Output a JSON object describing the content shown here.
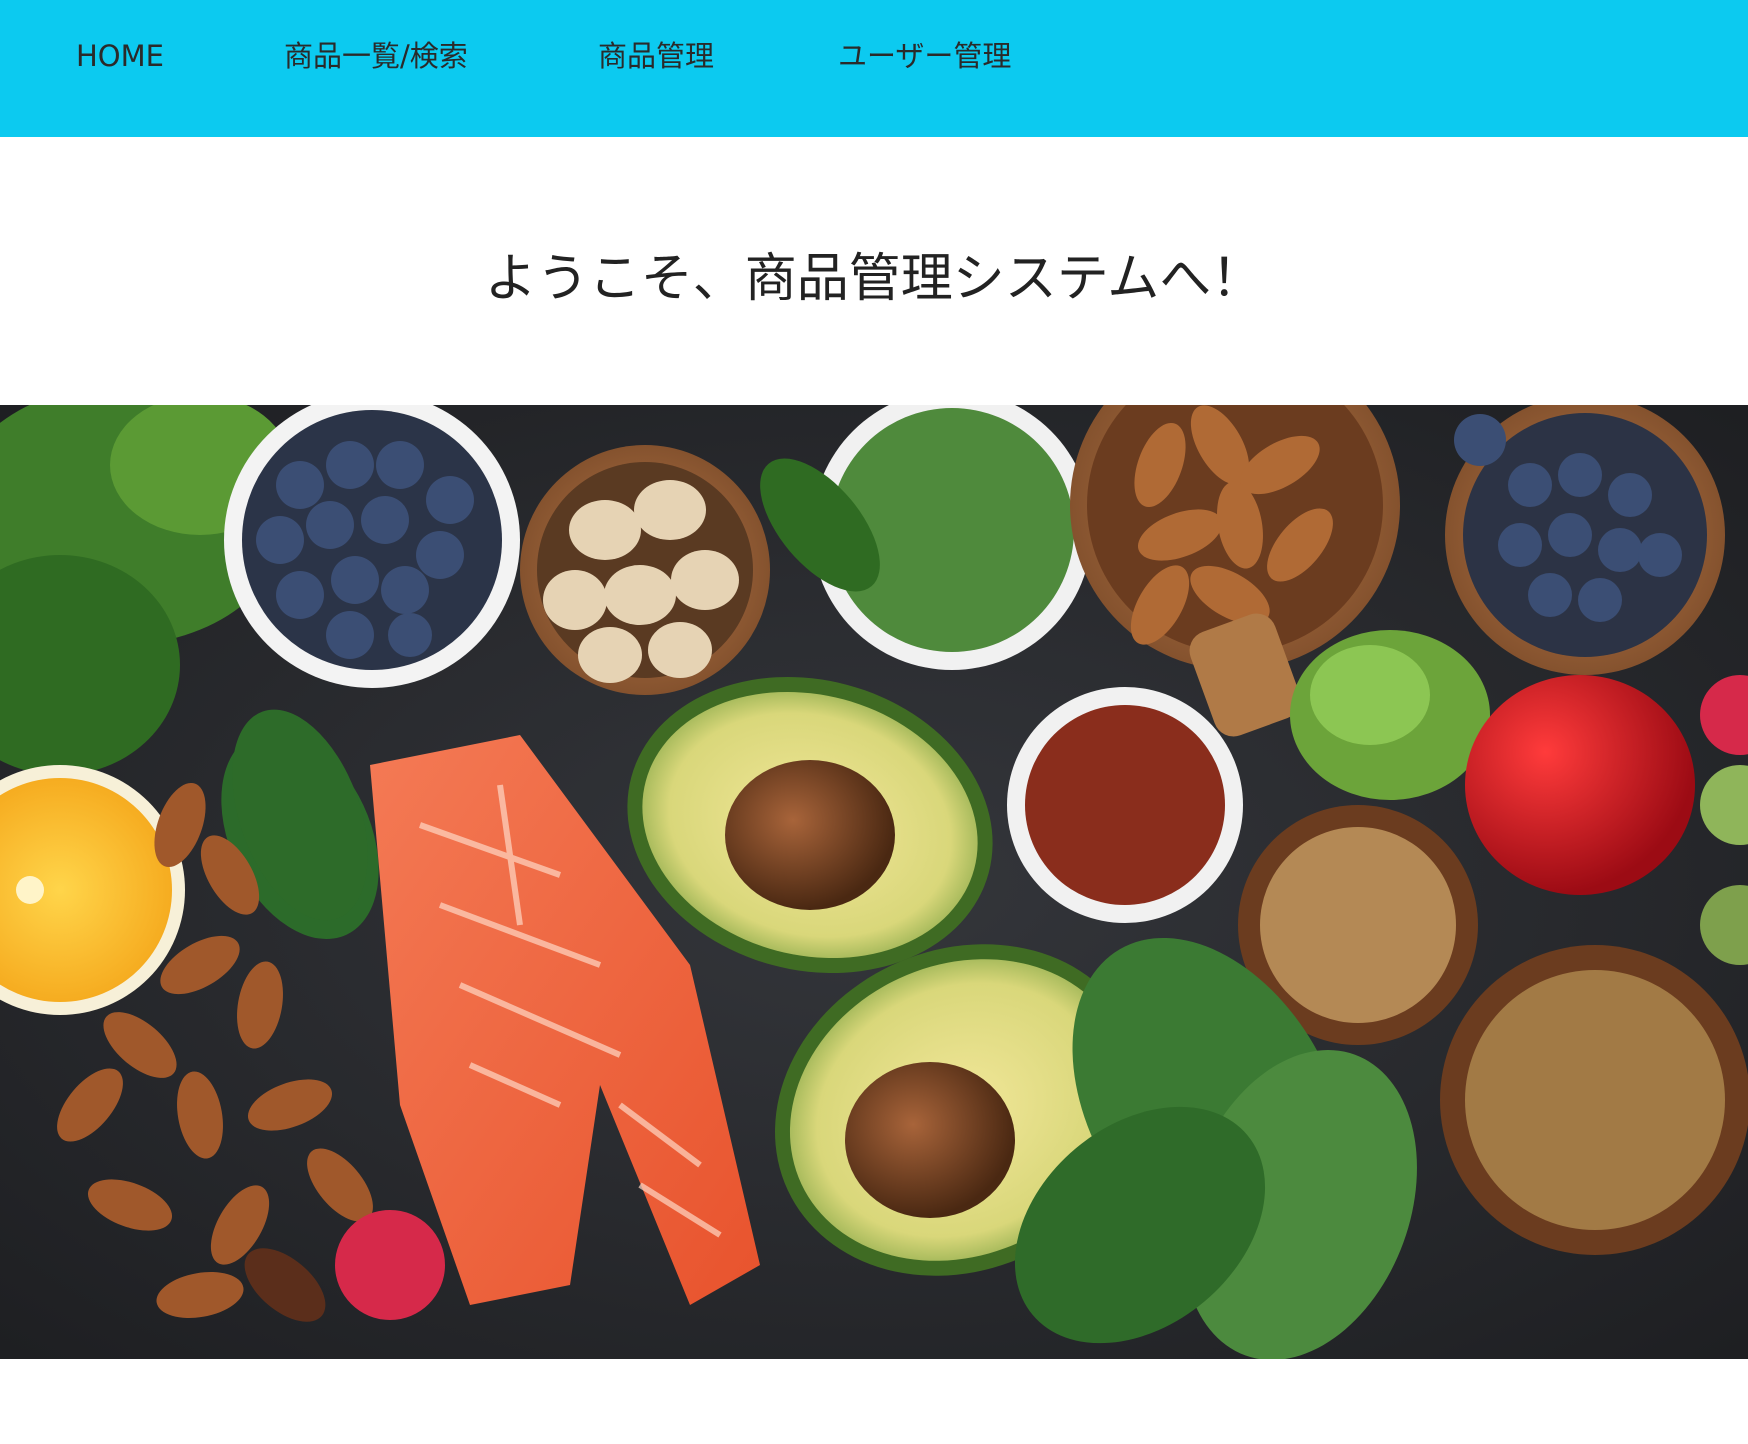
{
  "nav": {
    "items": [
      {
        "label": "HOME"
      },
      {
        "label": "商品一覧/検索"
      },
      {
        "label": "商品管理"
      },
      {
        "label": "ユーザー管理"
      }
    ],
    "background_color": "#0ccaf0"
  },
  "main": {
    "title": "ようこそ、商品管理システムへ！"
  },
  "hero": {
    "icon": "healthy-food-photo"
  }
}
